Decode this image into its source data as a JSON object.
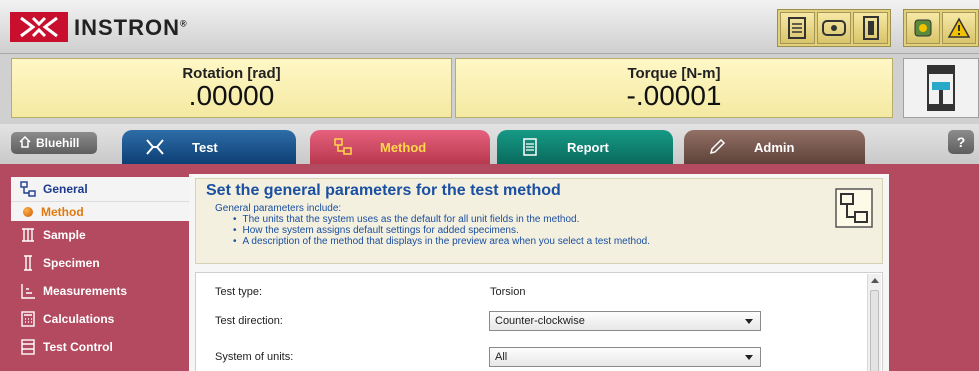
{
  "header": {
    "brand": "INSTRON",
    "brand_mark": "®",
    "icons_group1": [
      "specimen-load-icon",
      "crosshead-icon",
      "frame-icon"
    ],
    "icons_group2": [
      "settings-icon",
      "warning-icon"
    ]
  },
  "readouts": [
    {
      "label": "Rotation [rad]",
      "value": ".00000"
    },
    {
      "label": "Torque [N-m]",
      "value": "-.00001"
    }
  ],
  "tabs": {
    "bluehill": "Bluehill",
    "items": [
      {
        "label": "Test"
      },
      {
        "label": "Method"
      },
      {
        "label": "Report"
      },
      {
        "label": "Admin"
      }
    ],
    "help": "?"
  },
  "sidebar": {
    "items": [
      {
        "label": "General"
      },
      {
        "label": "Method"
      },
      {
        "label": "Sample"
      },
      {
        "label": "Specimen"
      },
      {
        "label": "Measurements"
      },
      {
        "label": "Calculations"
      },
      {
        "label": "Test Control"
      }
    ]
  },
  "info": {
    "title": "Set the general parameters for the test method",
    "intro": "General parameters include:",
    "bullets": [
      "The units that the system uses as the default for all unit fields in the method.",
      "How the system assigns default settings for added specimens.",
      "A description of the method that displays in the preview area when you select a test method."
    ]
  },
  "form": {
    "test_type_label": "Test type:",
    "test_type_value": "Torsion",
    "test_direction_label": "Test direction:",
    "test_direction_value": "Counter-clockwise",
    "units_label": "System of units:",
    "units_value": "All"
  },
  "colors": {
    "test_tab": "#1f5a94",
    "method_tab": "#c9465f",
    "report_tab": "#128271",
    "admin_tab": "#7a5a4f",
    "readout_bg": "#fbf2b8"
  }
}
